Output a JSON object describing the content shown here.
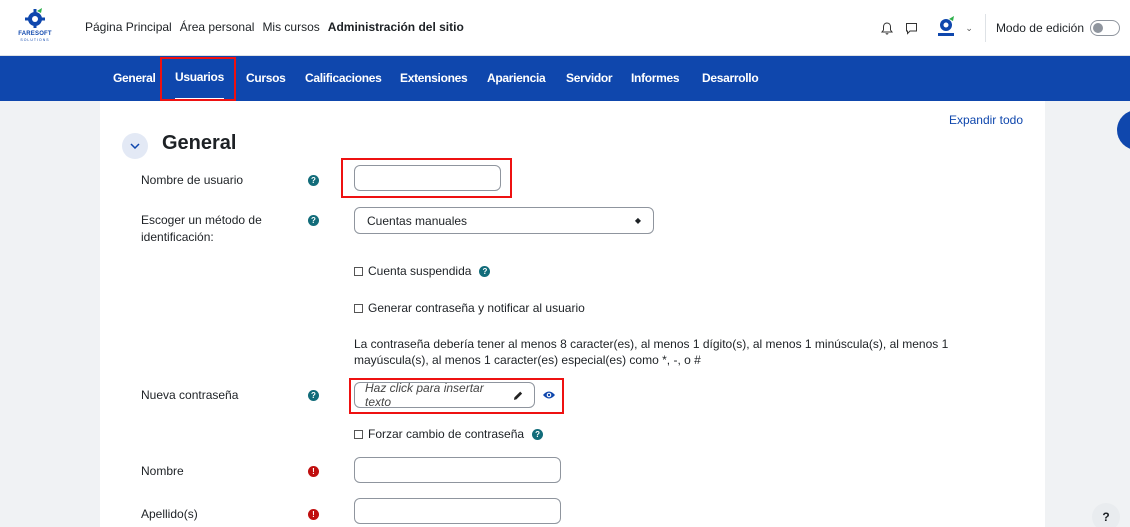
{
  "brand": {
    "name": "FARESOFT",
    "tagline": "SOLUTIONS"
  },
  "primary_nav": [
    {
      "label": "Página Principal",
      "active": false
    },
    {
      "label": "Área personal",
      "active": false
    },
    {
      "label": "Mis cursos",
      "active": false
    },
    {
      "label": "Administración del sitio",
      "active": true
    }
  ],
  "top_right": {
    "icons": [
      "bell-icon",
      "chat-icon"
    ],
    "edit_mode_label": "Modo de edición",
    "edit_mode_on": false
  },
  "secondary_nav": [
    {
      "label": "General",
      "active": false
    },
    {
      "label": "Usuarios",
      "active": true
    },
    {
      "label": "Cursos",
      "active": false
    },
    {
      "label": "Calificaciones",
      "active": false
    },
    {
      "label": "Extensiones",
      "active": false
    },
    {
      "label": "Apariencia",
      "active": false
    },
    {
      "label": "Servidor",
      "active": false
    },
    {
      "label": "Informes",
      "active": false
    },
    {
      "label": "Desarrollo",
      "active": false
    }
  ],
  "form": {
    "expand_all": "Expandir todo",
    "section_title": "General",
    "username_label": "Nombre de usuario",
    "username_value": "",
    "auth_label": "Escoger un método de identificación:",
    "auth_value": "Cuentas manuales",
    "suspended_label": "Cuenta suspendida",
    "generate_pwd_label": "Generar contraseña y notificar al usuario",
    "password_policy": "La contraseña debería tener al menos 8 caracter(es), al menos 1 dígito(s), al menos 1 minúscula(s), al menos 1 mayúscula(s), al menos 1 caracter(es) especial(es) como *, -, o #",
    "new_password_label": "Nueva contraseña",
    "new_password_placeholder": "Haz click para insertar texto",
    "force_change_label": "Forzar cambio de contraseña",
    "firstname_label": "Nombre",
    "firstname_value": "",
    "lastname_label": "Apellido(s)",
    "lastname_value": ""
  },
  "help_fab_label": "?",
  "colors": {
    "brand_blue": "#0f47ad",
    "help_teal": "#126c7a",
    "required_red": "#c00f0f",
    "highlight_red": "#e11111"
  }
}
